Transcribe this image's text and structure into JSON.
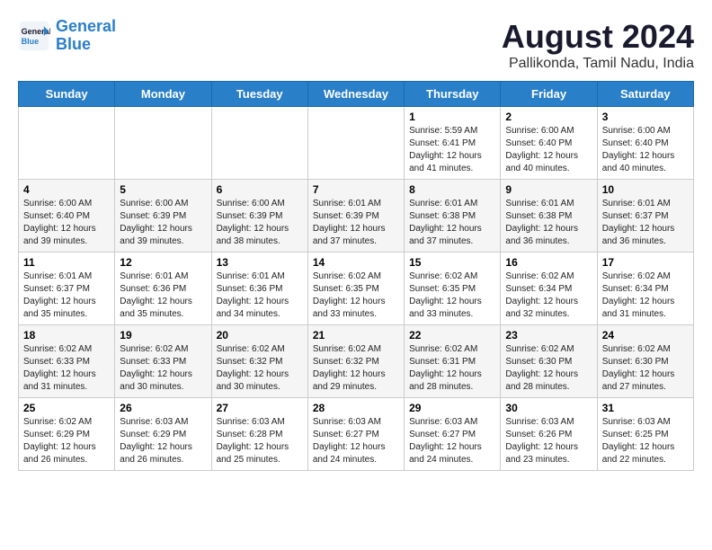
{
  "header": {
    "logo_line1": "General",
    "logo_line2": "Blue",
    "main_title": "August 2024",
    "subtitle": "Pallikonda, Tamil Nadu, India"
  },
  "weekdays": [
    "Sunday",
    "Monday",
    "Tuesday",
    "Wednesday",
    "Thursday",
    "Friday",
    "Saturday"
  ],
  "weeks": [
    [
      {
        "day": "",
        "info": ""
      },
      {
        "day": "",
        "info": ""
      },
      {
        "day": "",
        "info": ""
      },
      {
        "day": "",
        "info": ""
      },
      {
        "day": "1",
        "info": "Sunrise: 5:59 AM\nSunset: 6:41 PM\nDaylight: 12 hours and 41 minutes."
      },
      {
        "day": "2",
        "info": "Sunrise: 6:00 AM\nSunset: 6:40 PM\nDaylight: 12 hours and 40 minutes."
      },
      {
        "day": "3",
        "info": "Sunrise: 6:00 AM\nSunset: 6:40 PM\nDaylight: 12 hours and 40 minutes."
      }
    ],
    [
      {
        "day": "4",
        "info": "Sunrise: 6:00 AM\nSunset: 6:40 PM\nDaylight: 12 hours and 39 minutes."
      },
      {
        "day": "5",
        "info": "Sunrise: 6:00 AM\nSunset: 6:39 PM\nDaylight: 12 hours and 39 minutes."
      },
      {
        "day": "6",
        "info": "Sunrise: 6:00 AM\nSunset: 6:39 PM\nDaylight: 12 hours and 38 minutes."
      },
      {
        "day": "7",
        "info": "Sunrise: 6:01 AM\nSunset: 6:39 PM\nDaylight: 12 hours and 37 minutes."
      },
      {
        "day": "8",
        "info": "Sunrise: 6:01 AM\nSunset: 6:38 PM\nDaylight: 12 hours and 37 minutes."
      },
      {
        "day": "9",
        "info": "Sunrise: 6:01 AM\nSunset: 6:38 PM\nDaylight: 12 hours and 36 minutes."
      },
      {
        "day": "10",
        "info": "Sunrise: 6:01 AM\nSunset: 6:37 PM\nDaylight: 12 hours and 36 minutes."
      }
    ],
    [
      {
        "day": "11",
        "info": "Sunrise: 6:01 AM\nSunset: 6:37 PM\nDaylight: 12 hours and 35 minutes."
      },
      {
        "day": "12",
        "info": "Sunrise: 6:01 AM\nSunset: 6:36 PM\nDaylight: 12 hours and 35 minutes."
      },
      {
        "day": "13",
        "info": "Sunrise: 6:01 AM\nSunset: 6:36 PM\nDaylight: 12 hours and 34 minutes."
      },
      {
        "day": "14",
        "info": "Sunrise: 6:02 AM\nSunset: 6:35 PM\nDaylight: 12 hours and 33 minutes."
      },
      {
        "day": "15",
        "info": "Sunrise: 6:02 AM\nSunset: 6:35 PM\nDaylight: 12 hours and 33 minutes."
      },
      {
        "day": "16",
        "info": "Sunrise: 6:02 AM\nSunset: 6:34 PM\nDaylight: 12 hours and 32 minutes."
      },
      {
        "day": "17",
        "info": "Sunrise: 6:02 AM\nSunset: 6:34 PM\nDaylight: 12 hours and 31 minutes."
      }
    ],
    [
      {
        "day": "18",
        "info": "Sunrise: 6:02 AM\nSunset: 6:33 PM\nDaylight: 12 hours and 31 minutes."
      },
      {
        "day": "19",
        "info": "Sunrise: 6:02 AM\nSunset: 6:33 PM\nDaylight: 12 hours and 30 minutes."
      },
      {
        "day": "20",
        "info": "Sunrise: 6:02 AM\nSunset: 6:32 PM\nDaylight: 12 hours and 30 minutes."
      },
      {
        "day": "21",
        "info": "Sunrise: 6:02 AM\nSunset: 6:32 PM\nDaylight: 12 hours and 29 minutes."
      },
      {
        "day": "22",
        "info": "Sunrise: 6:02 AM\nSunset: 6:31 PM\nDaylight: 12 hours and 28 minutes."
      },
      {
        "day": "23",
        "info": "Sunrise: 6:02 AM\nSunset: 6:30 PM\nDaylight: 12 hours and 28 minutes."
      },
      {
        "day": "24",
        "info": "Sunrise: 6:02 AM\nSunset: 6:30 PM\nDaylight: 12 hours and 27 minutes."
      }
    ],
    [
      {
        "day": "25",
        "info": "Sunrise: 6:02 AM\nSunset: 6:29 PM\nDaylight: 12 hours and 26 minutes."
      },
      {
        "day": "26",
        "info": "Sunrise: 6:03 AM\nSunset: 6:29 PM\nDaylight: 12 hours and 26 minutes."
      },
      {
        "day": "27",
        "info": "Sunrise: 6:03 AM\nSunset: 6:28 PM\nDaylight: 12 hours and 25 minutes."
      },
      {
        "day": "28",
        "info": "Sunrise: 6:03 AM\nSunset: 6:27 PM\nDaylight: 12 hours and 24 minutes."
      },
      {
        "day": "29",
        "info": "Sunrise: 6:03 AM\nSunset: 6:27 PM\nDaylight: 12 hours and 24 minutes."
      },
      {
        "day": "30",
        "info": "Sunrise: 6:03 AM\nSunset: 6:26 PM\nDaylight: 12 hours and 23 minutes."
      },
      {
        "day": "31",
        "info": "Sunrise: 6:03 AM\nSunset: 6:25 PM\nDaylight: 12 hours and 22 minutes."
      }
    ]
  ]
}
